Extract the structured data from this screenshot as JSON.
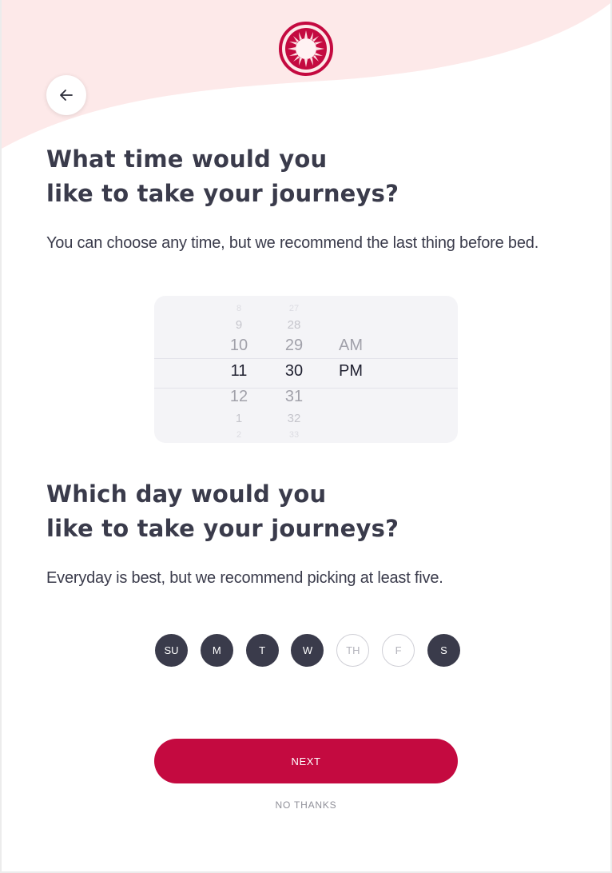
{
  "colors": {
    "accent": "#c40a40",
    "dark": "#3a3b4b",
    "wave": "#fde9e9"
  },
  "icons": {
    "logo": "sun-ring-logo",
    "back": "arrow-left-icon"
  },
  "time_section": {
    "title_line1": "What time would you",
    "title_line2": "like to take your journeys?",
    "subtitle": "You can choose any time, but we recommend the last thing before bed."
  },
  "time_picker": {
    "hours": [
      "8",
      "9",
      "10",
      "11",
      "12",
      "1",
      "2"
    ],
    "minutes": [
      "27",
      "28",
      "29",
      "30",
      "31",
      "32",
      "33"
    ],
    "periods": [
      "AM",
      "PM"
    ],
    "selected": {
      "hour": "11",
      "minute": "30",
      "period": "PM"
    }
  },
  "day_section": {
    "title_line1": "Which day would you",
    "title_line2": "like to take your journeys?",
    "subtitle": "Everyday is best, but we recommend picking at least five."
  },
  "days": [
    {
      "label": "SU",
      "selected": true
    },
    {
      "label": "M",
      "selected": true
    },
    {
      "label": "T",
      "selected": true
    },
    {
      "label": "W",
      "selected": true
    },
    {
      "label": "TH",
      "selected": false
    },
    {
      "label": "F",
      "selected": false
    },
    {
      "label": "S",
      "selected": true
    }
  ],
  "actions": {
    "next": "NEXT",
    "no_thanks": "NO THANKS"
  }
}
